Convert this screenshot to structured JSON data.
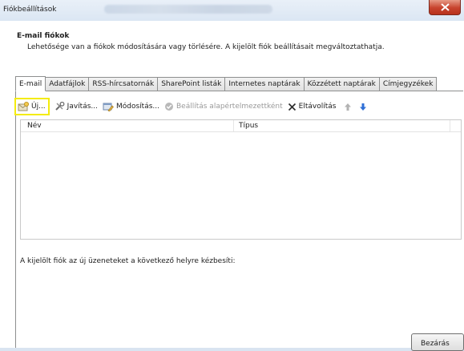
{
  "window": {
    "title": "Fiókbeállítások"
  },
  "header": {
    "title": "E-mail fiókok",
    "description": "Lehetősége van a fiókok módosítására vagy törlésére. A kijelölt fiók beállításait megváltoztathatja."
  },
  "tabs": [
    {
      "label": "E-mail",
      "active": true
    },
    {
      "label": "Adatfájlok"
    },
    {
      "label": "RSS-hírcsatornák"
    },
    {
      "label": "SharePoint listák"
    },
    {
      "label": "Internetes naptárak"
    },
    {
      "label": "Közzétett naptárak"
    },
    {
      "label": "Címjegyzékek"
    }
  ],
  "toolbar": {
    "new_label": "Új...",
    "repair_label": "Javítás...",
    "change_label": "Módosítás...",
    "set_default_label": "Beállítás alapértelmezettként",
    "remove_label": "Eltávolítás"
  },
  "list": {
    "col_name": "Név",
    "col_type": "Típus"
  },
  "deliver_text": "A kijelölt fiók az új üzeneteket a következő helyre kézbesíti:",
  "footer": {
    "close_label": "Bezárás"
  },
  "colors": {
    "highlight": "#f4ec0c",
    "close_red": "#c7432d",
    "arrow_blue": "#2f6fd6"
  }
}
